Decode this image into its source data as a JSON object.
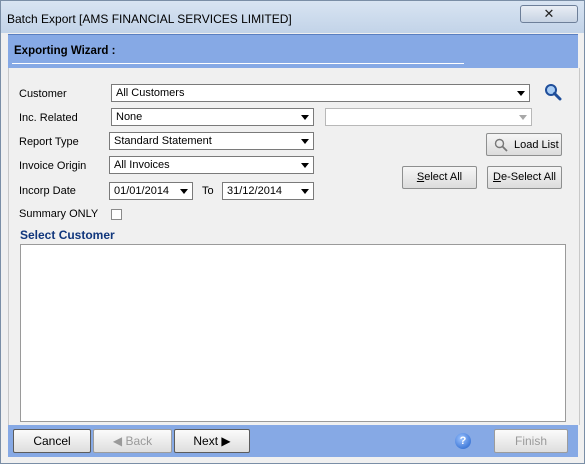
{
  "window": {
    "title": "Batch Export [AMS FINANCIAL SERVICES LIMITED]",
    "close_glyph": "✕"
  },
  "banner": {
    "title": "Exporting Wizard :"
  },
  "form": {
    "customer": {
      "label": "Customer",
      "value": "All Customers"
    },
    "inc_related": {
      "label": "Inc. Related",
      "value": "None",
      "secondary_value": ""
    },
    "report_type": {
      "label": "Report Type",
      "value": "Standard Statement"
    },
    "invoice_origin": {
      "label": "Invoice Origin",
      "value": "All Invoices"
    },
    "incorp_date": {
      "label": "Incorp Date",
      "from": "01/01/2014",
      "to_label": "To",
      "to": "31/12/2014"
    },
    "summary_only": {
      "label": "Summary ONLY",
      "checked": false
    }
  },
  "buttons": {
    "load_list": "Load List",
    "select_all_rest": "elect All",
    "select_all_accel": "S",
    "deselect_all_accel": "D",
    "deselect_all_rest": "e-Select All"
  },
  "select_customer": {
    "title": "Select Customer",
    "items": []
  },
  "footer": {
    "cancel": "Cancel",
    "back": "Back",
    "next": "Next",
    "finish": "Finish",
    "back_icon": "◀",
    "next_icon": "▶",
    "help_glyph": "?"
  }
}
